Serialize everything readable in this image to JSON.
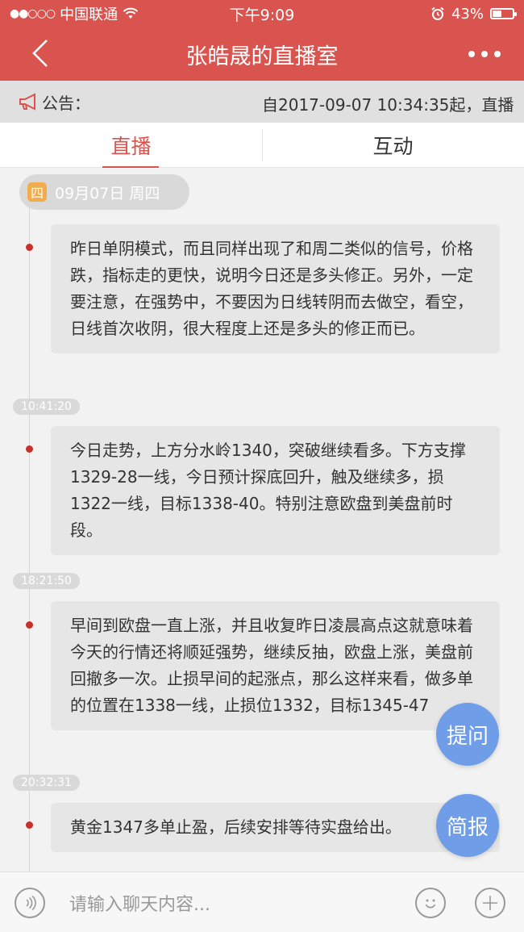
{
  "status_bar": {
    "carrier": "中国联通",
    "time": "下午9:09",
    "battery": "43%",
    "battery_level": 0.43
  },
  "header": {
    "title": "张皓晟的直播室"
  },
  "notice": {
    "label": "公告：",
    "text": "自2017-09-07 10:34:35起，直播"
  },
  "tabs": [
    {
      "label": "直播",
      "active": true
    },
    {
      "label": "互动",
      "active": false
    }
  ],
  "timeline": {
    "date_day": "四",
    "date_label": "09月07日  周四",
    "posts": [
      {
        "text": "昨日单阴模式，而且同样出现了和周二类似的信号，价格跌，指标走的更快，说明今日还是多头修正。另外，一定要注意，在强势中，不要因为日线转阴而去做空，看空，日线首次收阴，很大程度上还是多头的修正而已。"
      },
      {
        "time": "10:41:20",
        "text": "今日走势，上方分水岭1340，突破继续看多。下方支撑1329-28一线，今日预计探底回升，触及继续多，损1322一线，目标1338-40。特别注意欧盘到美盘前时段。"
      },
      {
        "time": "18:21:50",
        "text": "早间到欧盘一直上涨，并且收复昨日凌晨高点这就意味着今天的行情还将顺延强势，继续反抽，欧盘上涨，美盘前回撤多一次。止损早间的起涨点，那么这样来看，做多单的位置在1338一线，止损位1332，目标1345-47"
      },
      {
        "time": "20:32:31",
        "text": "黄金1347多单止盈，后续安排等待实盘给出。"
      }
    ]
  },
  "floating": {
    "ask": "提问",
    "brief": "简报"
  },
  "input": {
    "placeholder": "请输入聊天内容..."
  },
  "colors": {
    "header_bg": "#d9534f",
    "accent": "#d9534f",
    "float_btn": "#6f9de8"
  }
}
